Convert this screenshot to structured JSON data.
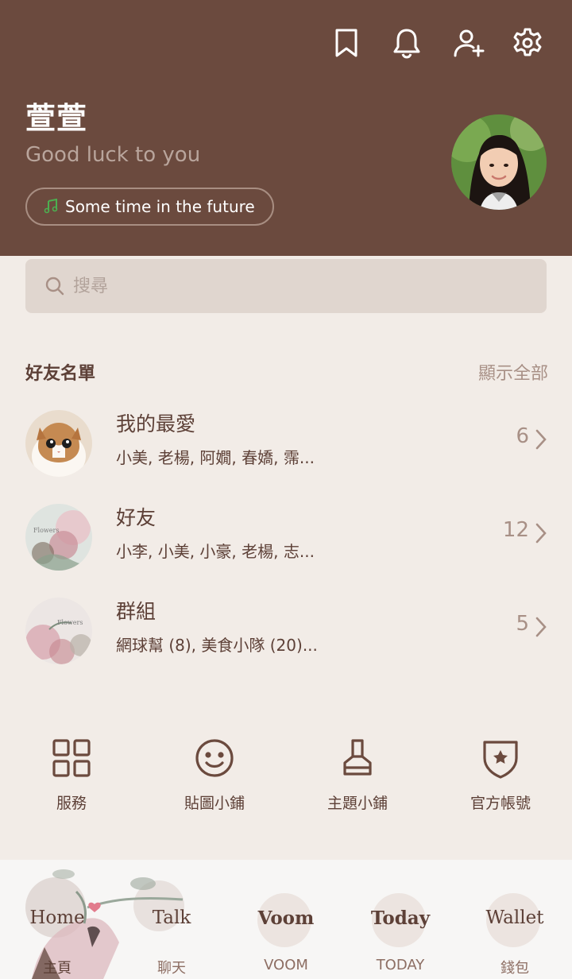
{
  "header": {
    "name": "萱萱",
    "status_message": "Good luck to you",
    "music": "Some time in the future",
    "icons": [
      "bookmark-icon",
      "bell-icon",
      "add-friend-icon",
      "gear-icon"
    ]
  },
  "search": {
    "placeholder": "搜尋"
  },
  "friends": {
    "title": "好友名單",
    "show_all": "顯示全部",
    "rows": [
      {
        "title": "我的最愛",
        "subtitle": "小美, 老楊, 阿嫺, 春嬌, 霈...",
        "count": "6"
      },
      {
        "title": "好友",
        "subtitle": "小李, 小美, 小豪, 老楊, 志...",
        "count": "12"
      },
      {
        "title": "群組",
        "subtitle": "網球幫 (8), 美食小隊 (20)...",
        "count": "5"
      }
    ]
  },
  "shortcuts": [
    {
      "label": "服務",
      "icon": "grid-icon"
    },
    {
      "label": "貼圖小鋪",
      "icon": "smiley-icon"
    },
    {
      "label": "主題小鋪",
      "icon": "brush-icon"
    },
    {
      "label": "官方帳號",
      "icon": "shield-star-icon"
    }
  ],
  "tabbar": [
    {
      "script": "Home",
      "label": "主頁"
    },
    {
      "script": "Talk",
      "label": "聊天"
    },
    {
      "script": "Voom",
      "label": "VOOM"
    },
    {
      "script": "Today",
      "label": "TODAY"
    },
    {
      "script": "Wallet",
      "label": "錢包"
    }
  ],
  "colors": {
    "header_bg": "#6b4a3e",
    "page_bg": "#f2ece7",
    "search_bg": "#e0d6cf",
    "text_brown": "#5d4037",
    "muted": "#a89086",
    "music_note": "#4caf50"
  }
}
